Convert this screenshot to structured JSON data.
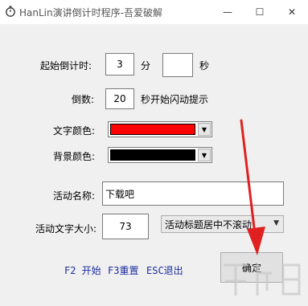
{
  "window": {
    "title": "HanLin演讲倒计时程序-吾爱破解",
    "controls": {
      "minimize": "—",
      "maximize": "☐",
      "close": "✕"
    }
  },
  "countdown": {
    "label": "起始倒计时:",
    "minutes_value": "3",
    "minutes_unit": "分",
    "seconds_value": "",
    "seconds_unit": "秒"
  },
  "flash": {
    "label": "倒数:",
    "value": "20",
    "suffix": "秒开始闪动提示"
  },
  "text_color": {
    "label": "文字颜色:",
    "color": "#ff0000"
  },
  "bg_color": {
    "label": "背景颜色:",
    "color": "#000000"
  },
  "activity": {
    "name_label": "活动名称:",
    "name_value": "下载吧",
    "size_label": "活动文字大小:",
    "size_value": "73",
    "scroll_option": "活动标题居中不滚动"
  },
  "hotkeys": {
    "f2": "F2 开始",
    "f3": "F3重置",
    "esc": "ESC退出"
  },
  "ok_button": "确定",
  "icons": {
    "app": "stopwatch-icon",
    "dropdown": "chevron-down-icon"
  },
  "annotation": {
    "arrow_color": "#e02020"
  }
}
